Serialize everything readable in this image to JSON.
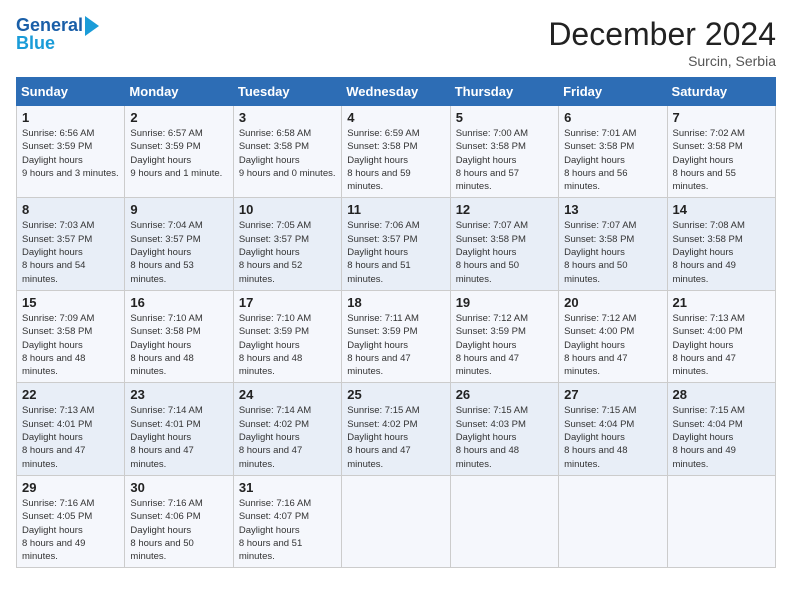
{
  "header": {
    "logo_line1": "General",
    "logo_line2": "Blue",
    "month": "December 2024",
    "location": "Surcin, Serbia"
  },
  "weekdays": [
    "Sunday",
    "Monday",
    "Tuesday",
    "Wednesday",
    "Thursday",
    "Friday",
    "Saturday"
  ],
  "weeks": [
    [
      {
        "day": "1",
        "sunrise": "6:56 AM",
        "sunset": "3:59 PM",
        "daylight": "9 hours and 3 minutes."
      },
      {
        "day": "2",
        "sunrise": "6:57 AM",
        "sunset": "3:59 PM",
        "daylight": "9 hours and 1 minute."
      },
      {
        "day": "3",
        "sunrise": "6:58 AM",
        "sunset": "3:58 PM",
        "daylight": "9 hours and 0 minutes."
      },
      {
        "day": "4",
        "sunrise": "6:59 AM",
        "sunset": "3:58 PM",
        "daylight": "8 hours and 59 minutes."
      },
      {
        "day": "5",
        "sunrise": "7:00 AM",
        "sunset": "3:58 PM",
        "daylight": "8 hours and 57 minutes."
      },
      {
        "day": "6",
        "sunrise": "7:01 AM",
        "sunset": "3:58 PM",
        "daylight": "8 hours and 56 minutes."
      },
      {
        "day": "7",
        "sunrise": "7:02 AM",
        "sunset": "3:58 PM",
        "daylight": "8 hours and 55 minutes."
      }
    ],
    [
      {
        "day": "8",
        "sunrise": "7:03 AM",
        "sunset": "3:57 PM",
        "daylight": "8 hours and 54 minutes."
      },
      {
        "day": "9",
        "sunrise": "7:04 AM",
        "sunset": "3:57 PM",
        "daylight": "8 hours and 53 minutes."
      },
      {
        "day": "10",
        "sunrise": "7:05 AM",
        "sunset": "3:57 PM",
        "daylight": "8 hours and 52 minutes."
      },
      {
        "day": "11",
        "sunrise": "7:06 AM",
        "sunset": "3:57 PM",
        "daylight": "8 hours and 51 minutes."
      },
      {
        "day": "12",
        "sunrise": "7:07 AM",
        "sunset": "3:58 PM",
        "daylight": "8 hours and 50 minutes."
      },
      {
        "day": "13",
        "sunrise": "7:07 AM",
        "sunset": "3:58 PM",
        "daylight": "8 hours and 50 minutes."
      },
      {
        "day": "14",
        "sunrise": "7:08 AM",
        "sunset": "3:58 PM",
        "daylight": "8 hours and 49 minutes."
      }
    ],
    [
      {
        "day": "15",
        "sunrise": "7:09 AM",
        "sunset": "3:58 PM",
        "daylight": "8 hours and 48 minutes."
      },
      {
        "day": "16",
        "sunrise": "7:10 AM",
        "sunset": "3:58 PM",
        "daylight": "8 hours and 48 minutes."
      },
      {
        "day": "17",
        "sunrise": "7:10 AM",
        "sunset": "3:59 PM",
        "daylight": "8 hours and 48 minutes."
      },
      {
        "day": "18",
        "sunrise": "7:11 AM",
        "sunset": "3:59 PM",
        "daylight": "8 hours and 47 minutes."
      },
      {
        "day": "19",
        "sunrise": "7:12 AM",
        "sunset": "3:59 PM",
        "daylight": "8 hours and 47 minutes."
      },
      {
        "day": "20",
        "sunrise": "7:12 AM",
        "sunset": "4:00 PM",
        "daylight": "8 hours and 47 minutes."
      },
      {
        "day": "21",
        "sunrise": "7:13 AM",
        "sunset": "4:00 PM",
        "daylight": "8 hours and 47 minutes."
      }
    ],
    [
      {
        "day": "22",
        "sunrise": "7:13 AM",
        "sunset": "4:01 PM",
        "daylight": "8 hours and 47 minutes."
      },
      {
        "day": "23",
        "sunrise": "7:14 AM",
        "sunset": "4:01 PM",
        "daylight": "8 hours and 47 minutes."
      },
      {
        "day": "24",
        "sunrise": "7:14 AM",
        "sunset": "4:02 PM",
        "daylight": "8 hours and 47 minutes."
      },
      {
        "day": "25",
        "sunrise": "7:15 AM",
        "sunset": "4:02 PM",
        "daylight": "8 hours and 47 minutes."
      },
      {
        "day": "26",
        "sunrise": "7:15 AM",
        "sunset": "4:03 PM",
        "daylight": "8 hours and 48 minutes."
      },
      {
        "day": "27",
        "sunrise": "7:15 AM",
        "sunset": "4:04 PM",
        "daylight": "8 hours and 48 minutes."
      },
      {
        "day": "28",
        "sunrise": "7:15 AM",
        "sunset": "4:04 PM",
        "daylight": "8 hours and 49 minutes."
      }
    ],
    [
      {
        "day": "29",
        "sunrise": "7:16 AM",
        "sunset": "4:05 PM",
        "daylight": "8 hours and 49 minutes."
      },
      {
        "day": "30",
        "sunrise": "7:16 AM",
        "sunset": "4:06 PM",
        "daylight": "8 hours and 50 minutes."
      },
      {
        "day": "31",
        "sunrise": "7:16 AM",
        "sunset": "4:07 PM",
        "daylight": "8 hours and 51 minutes."
      },
      null,
      null,
      null,
      null
    ]
  ],
  "labels": {
    "sunrise": "Sunrise: ",
    "sunset": "Sunset: ",
    "daylight": "Daylight hours"
  }
}
